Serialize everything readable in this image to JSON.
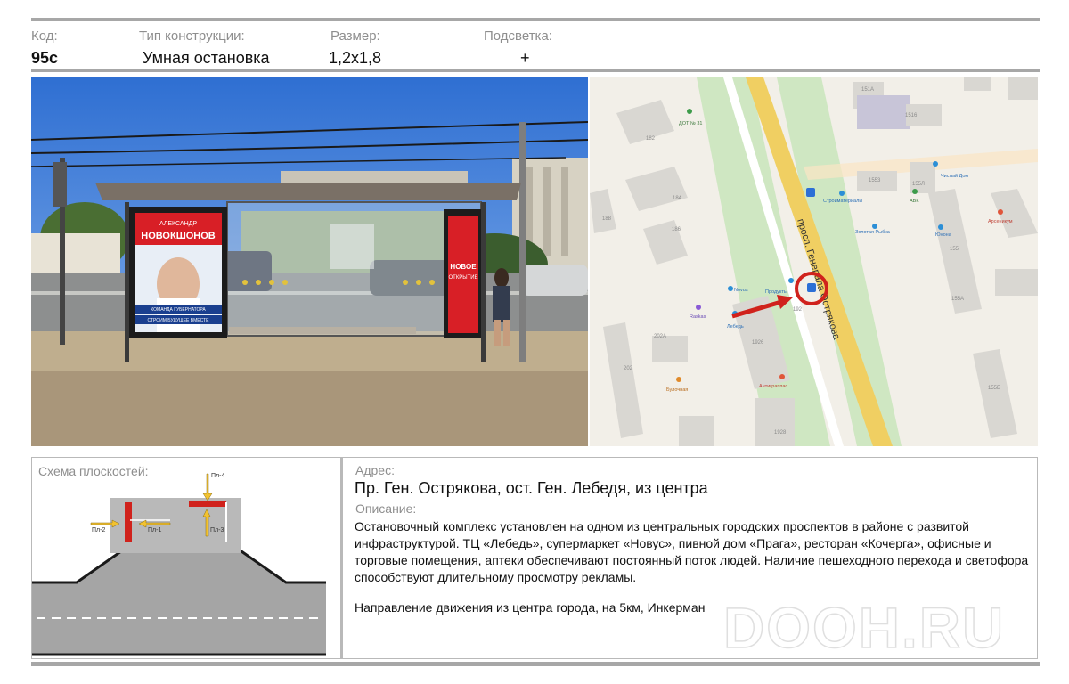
{
  "header": {
    "code_label": "Код:",
    "code_value": "95с",
    "type_label": "Тип конструкции:",
    "type_value": "Умная остановка",
    "size_label": "Размер:",
    "size_value": "1,2х1,8",
    "light_label": "Подсветка:",
    "light_value": "+"
  },
  "photo": {
    "poster_left": {
      "line1": "АЛЕКСАНДР",
      "line2": "НОВОКШОНОВ",
      "line3": "КОМАНДА ГУБЕРНАТОРА",
      "line4": "СТРОИМ БУДУЩЕЕ ВМЕСТЕ"
    },
    "poster_right": {
      "line1": "НОВОЕ",
      "line2": "ОТКРЫТИЕ"
    }
  },
  "map": {
    "street_label": "просп. Генерала Острякова",
    "labels": {
      "dot31": "ДОТ № 31",
      "b151a": "151А",
      "b1516": "1516",
      "b182": "182",
      "b184": "184",
      "b186": "186",
      "b188": "188",
      "b1553": "1553",
      "b155l": "155Л",
      "b155": "155",
      "b155a": "155А",
      "b155b": "155Б",
      "b202a": "202А",
      "b202": "202",
      "b1926": "1926",
      "b1928": "1928",
      "b192": "192",
      "chistyi_dom": "Чистый Дом",
      "stroimaterialy": "Стройматериалы",
      "avk": "АВК",
      "arsenikum": "Арсеникум",
      "zolotaya_rybka": "Золотая Рыбка",
      "yunona": "Юнона",
      "novus": "Novus",
      "produkty": "Продукты",
      "raskas": "Raskas",
      "lebed": "Лебедь",
      "bulochnaya": "Булочная",
      "antigrippas": "Антиграппас"
    }
  },
  "scheme": {
    "title": "Схема плоскостей:",
    "labels": [
      "Пл-1",
      "Пл-2",
      "Пл-3",
      "Пл-4"
    ]
  },
  "address": {
    "label": "Адрес:",
    "value": "Пр. Ген. Острякова,  ост. Ген. Лебедя, из центра"
  },
  "description": {
    "label": "Описание:",
    "text": "Остановочный комплекс установлен на одном из центральных городских проспектов в районе с развитой инфраструктурой. ТЦ «Лебедь», супермаркет «Новус», пивной дом «Прага», ресторан «Кочерга», офисные и торговые помещения, аптеки обеспечивают постоянный поток людей. Наличие пешеходного перехода и светофора способствуют длительному просмотру рекламы.",
    "direction": "Направление движения из центра города, на 5км, Инкерман"
  },
  "watermark": "DOOH.RU",
  "colors": {
    "accent_red": "#d0221c",
    "arrow_yellow": "#f2c230",
    "road_yellow": "#f0cf62",
    "map_bg": "#f2efe8"
  }
}
